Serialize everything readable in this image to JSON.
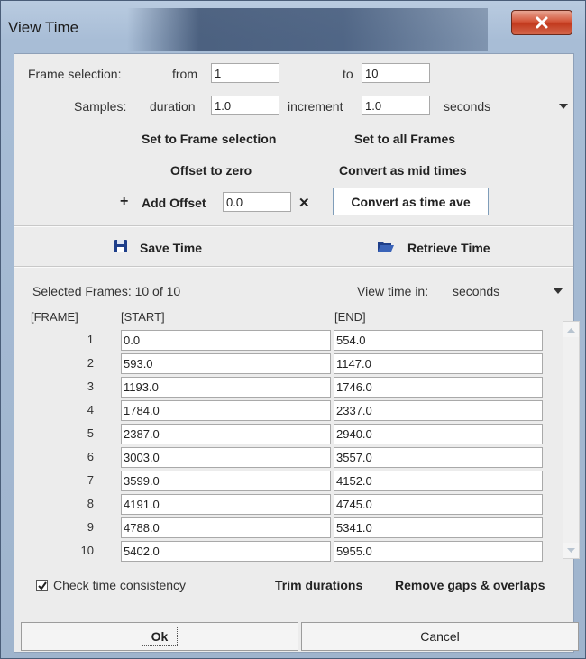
{
  "window": {
    "title": "View Time"
  },
  "frame_selection": {
    "label": "Frame selection:",
    "from_label": "from",
    "from_value": "1",
    "to_label": "to",
    "to_value": "10"
  },
  "samples": {
    "label": "Samples:",
    "duration_label": "duration",
    "duration_value": "1.0",
    "increment_label": "increment",
    "increment_value": "1.0",
    "unit": "seconds"
  },
  "actions": {
    "set_to_frame_selection": "Set to Frame selection",
    "set_to_all_frames": "Set to all Frames",
    "offset_to_zero": "Offset to zero",
    "convert_as_mid_times": "Convert as mid times",
    "add_offset_label": "Add Offset",
    "add_offset_value": "0.0",
    "convert_as_time_ave": "Convert as time ave"
  },
  "file": {
    "save_time": "Save Time",
    "retrieve_time": "Retrieve Time"
  },
  "table": {
    "selected_frames": "Selected Frames: 10 of 10",
    "view_time_in_label": "View time in:",
    "view_time_unit": "seconds",
    "headers": [
      "[FRAME]",
      "[START]",
      "[END]"
    ],
    "rows": [
      {
        "frame": "1",
        "start": "0.0",
        "end": "554.0"
      },
      {
        "frame": "2",
        "start": "593.0",
        "end": "1147.0"
      },
      {
        "frame": "3",
        "start": "1193.0",
        "end": "1746.0"
      },
      {
        "frame": "4",
        "start": "1784.0",
        "end": "2337.0"
      },
      {
        "frame": "5",
        "start": "2387.0",
        "end": "2940.0"
      },
      {
        "frame": "6",
        "start": "3003.0",
        "end": "3557.0"
      },
      {
        "frame": "7",
        "start": "3599.0",
        "end": "4152.0"
      },
      {
        "frame": "8",
        "start": "4191.0",
        "end": "4745.0"
      },
      {
        "frame": "9",
        "start": "4788.0",
        "end": "5341.0"
      },
      {
        "frame": "10",
        "start": "5402.0",
        "end": "5955.0"
      }
    ]
  },
  "bottom": {
    "check_time_consistency": "Check time consistency",
    "check_time_consistency_checked": true,
    "trim_durations": "Trim durations",
    "remove_gaps": "Remove gaps & overlaps"
  },
  "footer": {
    "ok": "Ok",
    "cancel": "Cancel"
  },
  "icons": {
    "close": "close-icon",
    "dropdown": "chevron-down-icon",
    "plus": "plus-icon",
    "clear": "clear-icon",
    "save": "floppy-disk-icon",
    "retrieve": "open-folder-icon",
    "check": "checkmark-icon"
  },
  "colors": {
    "close_button": "#c9452a",
    "window_frame": "#a8bdd6",
    "panel": "#ececec",
    "field_border": "#7f9db9"
  }
}
